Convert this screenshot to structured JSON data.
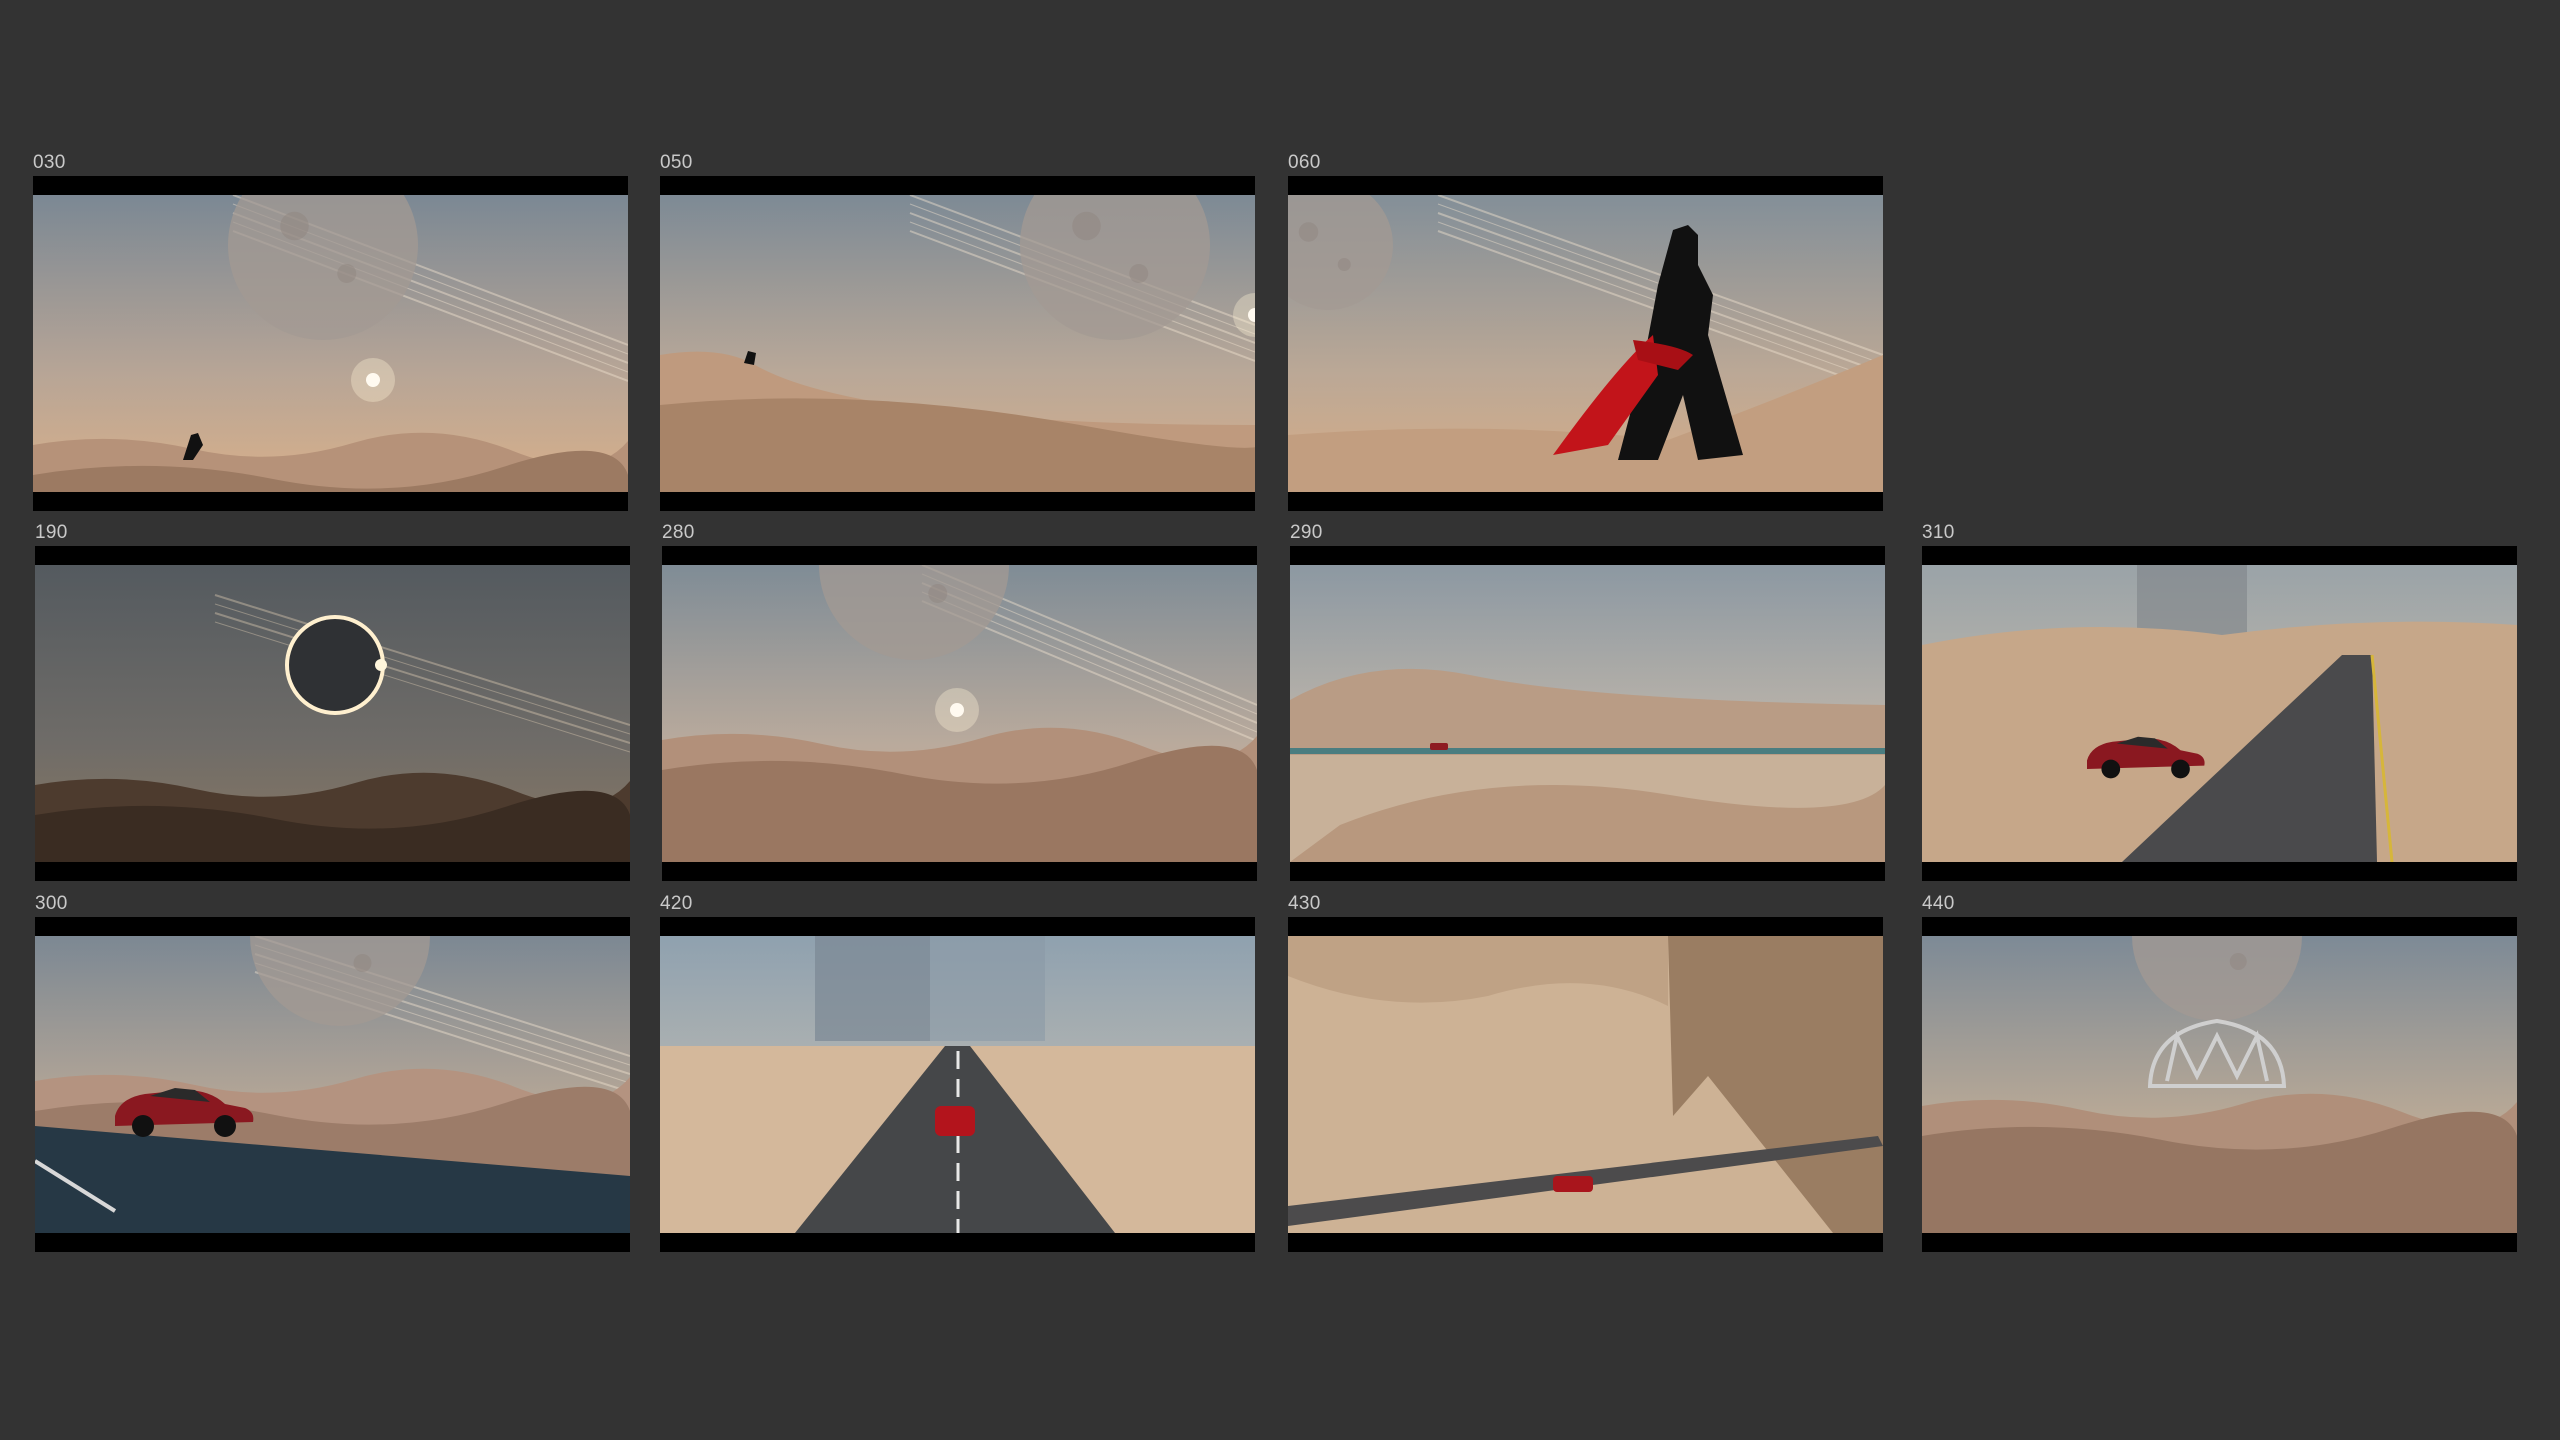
{
  "board": {
    "background": "#333333",
    "shots": [
      {
        "label": "030",
        "scene": "figure-dune-moon"
      },
      {
        "label": "050",
        "scene": "figure-ridge-moon"
      },
      {
        "label": "060",
        "scene": "woman-red-dress"
      },
      {
        "label": "190",
        "scene": "eclipse-desert"
      },
      {
        "label": "280",
        "scene": "moon-sunrise-dunes"
      },
      {
        "label": "290",
        "scene": "car-desert-road-wide"
      },
      {
        "label": "310",
        "scene": "car-road-monolith"
      },
      {
        "label": "300",
        "scene": "car-front-moon"
      },
      {
        "label": "420",
        "scene": "car-road-monoliths-aerial"
      },
      {
        "label": "430",
        "scene": "car-aerial-monolith-shadow"
      },
      {
        "label": "440",
        "scene": "maybach-logo-dunes"
      }
    ]
  }
}
